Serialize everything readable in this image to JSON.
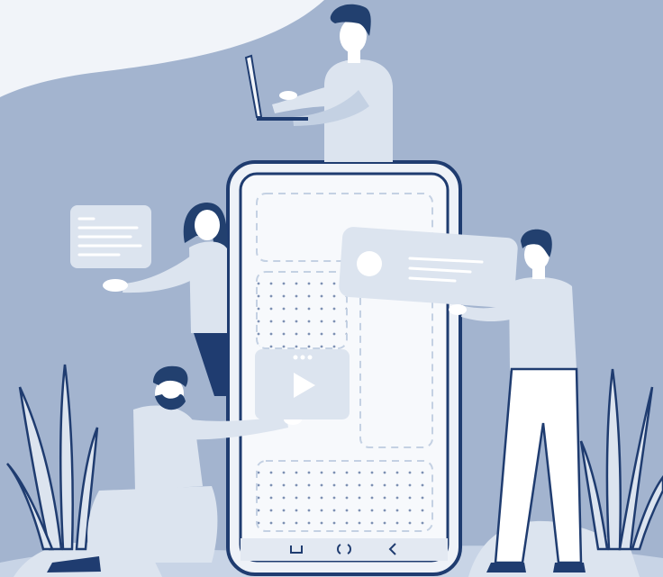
{
  "palette": {
    "background": "#a3b4cf",
    "curve": "#f1f4f9",
    "navy": "#1f3c70",
    "light": "#dce4ef",
    "mid": "#c4d1e3",
    "skin": "#ffffff",
    "hair": "#22406f"
  },
  "illustration": {
    "figures": [
      "person-with-laptop",
      "woman-presenting-card",
      "kneeling-man-with-video",
      "standing-man-with-card"
    ],
    "phone": {
      "nav_icons": [
        "square-icon",
        "circle-icon",
        "back-chevron-icon"
      ]
    },
    "cards": [
      "text-card",
      "profile-card",
      "video-card"
    ],
    "plants": [
      "left-plant",
      "right-plant"
    ]
  }
}
